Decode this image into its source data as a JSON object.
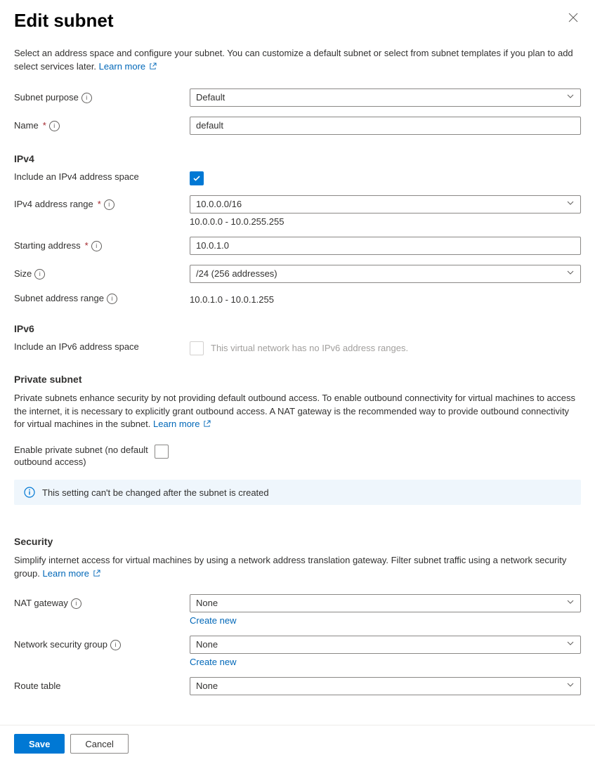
{
  "header": {
    "title": "Edit subnet"
  },
  "intro": {
    "text": "Select an address space and configure your subnet. You can customize a default subnet or select from subnet templates if you plan to add select services later.",
    "learn_more": "Learn more"
  },
  "fields": {
    "subnet_purpose": {
      "label": "Subnet purpose",
      "value": "Default"
    },
    "name": {
      "label": "Name",
      "value": "default"
    }
  },
  "ipv4": {
    "heading": "IPv4",
    "include_label": "Include an IPv4 address space",
    "include_checked": true,
    "range": {
      "label": "IPv4 address range",
      "value": "10.0.0.0/16",
      "hint": "10.0.0.0 - 10.0.255.255"
    },
    "start": {
      "label": "Starting address",
      "value": "10.0.1.0"
    },
    "size": {
      "label": "Size",
      "value": "/24 (256 addresses)"
    },
    "subnet_range": {
      "label": "Subnet address range",
      "value": "10.0.1.0 - 10.0.1.255"
    }
  },
  "ipv6": {
    "heading": "IPv6",
    "include_label": "Include an IPv6 address space",
    "disabled_text": "This virtual network has no IPv6 address ranges."
  },
  "private": {
    "heading": "Private subnet",
    "desc": "Private subnets enhance security by not providing default outbound access. To enable outbound connectivity for virtual machines to access the internet, it is necessary to explicitly grant outbound access. A NAT gateway is the recommended way to provide outbound connectivity for virtual machines in the subnet.",
    "learn_more": "Learn more",
    "enable_label": "Enable private subnet (no default outbound access)",
    "banner": "This setting can't be changed after the subnet is created"
  },
  "security": {
    "heading": "Security",
    "desc": "Simplify internet access for virtual machines by using a network address translation gateway. Filter subnet traffic using a network security group.",
    "learn_more": "Learn more",
    "nat": {
      "label": "NAT gateway",
      "value": "None",
      "create": "Create new"
    },
    "nsg": {
      "label": "Network security group",
      "value": "None",
      "create": "Create new"
    },
    "route": {
      "label": "Route table",
      "value": "None"
    }
  },
  "footer": {
    "save": "Save",
    "cancel": "Cancel"
  }
}
